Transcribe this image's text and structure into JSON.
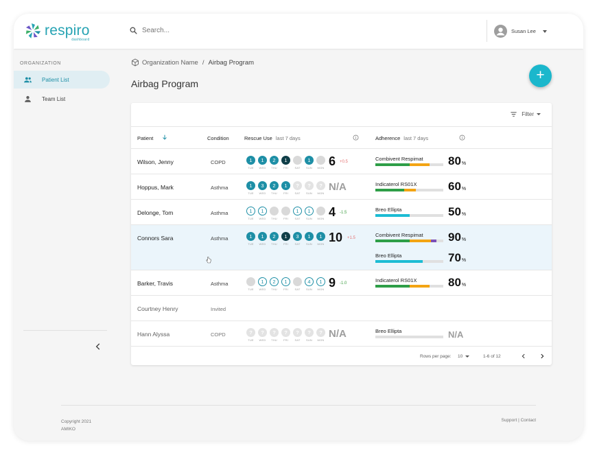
{
  "brand": {
    "name": "respiro",
    "sub": "dashboard",
    "colors": [
      "#26a3b3",
      "#3fb06a",
      "#6b57c7",
      "#1e8fa6"
    ]
  },
  "search": {
    "placeholder": "Search..."
  },
  "user": {
    "name": "Susan Lee"
  },
  "sidebar": {
    "heading": "ORGANIZATION",
    "items": [
      {
        "label": "Patient List",
        "icon": "patients-icon",
        "active": true
      },
      {
        "label": "Team List",
        "icon": "team-icon",
        "active": false
      }
    ]
  },
  "breadcrumb": {
    "org": "Organization Name",
    "separator": "/",
    "current": "Airbag Program"
  },
  "page_title": "Airbag Program",
  "filter_label": "Filter",
  "table": {
    "headers": {
      "patient": "Patient",
      "condition": "Condition",
      "rescue": "Rescue Use",
      "rescue_period": "last 7 days",
      "adherence": "Adherence",
      "adherence_period": "last 7 days"
    },
    "day_labels": [
      "TUE",
      "WED",
      "THU",
      "FRI",
      "SAT",
      "SUN",
      "MON"
    ],
    "rows": [
      {
        "name": "Wilson, Jenny",
        "condition": "COPD",
        "dim": false,
        "selected": false,
        "days": [
          {
            "v": "1",
            "s": "full"
          },
          {
            "v": "1",
            "s": "full"
          },
          {
            "v": "2",
            "s": "full"
          },
          {
            "v": "1",
            "s": "dark"
          },
          {
            "v": "",
            "s": "empty"
          },
          {
            "v": "1",
            "s": "full"
          },
          {
            "v": "",
            "s": "empty"
          }
        ],
        "total": "6",
        "delta": "+0.5",
        "delta_dir": "up",
        "meds": [
          {
            "name": "Combivent Respimat",
            "pct": "80",
            "bar": [
              {
                "c": "#2e9e47",
                "w": 0.51
              },
              {
                "c": "#f3a413",
                "w": 0.29
              }
            ]
          }
        ]
      },
      {
        "name": "Hoppus, Mark",
        "condition": "Asthma",
        "dim": false,
        "selected": false,
        "days": [
          {
            "v": "1",
            "s": "full"
          },
          {
            "v": "3",
            "s": "full"
          },
          {
            "v": "2",
            "s": "full"
          },
          {
            "v": "1",
            "s": "full"
          },
          {
            "v": "?",
            "s": "unk"
          },
          {
            "v": "?",
            "s": "unk"
          },
          {
            "v": "?",
            "s": "unk"
          }
        ],
        "total": "N/A",
        "delta": "",
        "delta_dir": "",
        "meds": [
          {
            "name": "Indicaterol RS01X",
            "pct": "60",
            "bar": [
              {
                "c": "#2e9e47",
                "w": 0.42
              },
              {
                "c": "#f3a413",
                "w": 0.18
              }
            ]
          }
        ]
      },
      {
        "name": "Delonge, Tom",
        "condition": "Asthma",
        "dim": false,
        "selected": false,
        "days": [
          {
            "v": "1",
            "s": "outline"
          },
          {
            "v": "1",
            "s": "outline"
          },
          {
            "v": "",
            "s": "empty"
          },
          {
            "v": "",
            "s": "empty"
          },
          {
            "v": "1",
            "s": "outline"
          },
          {
            "v": "1",
            "s": "outline"
          },
          {
            "v": "",
            "s": "empty"
          }
        ],
        "total": "4",
        "delta": "-1.5",
        "delta_dir": "down",
        "meds": [
          {
            "name": "Breo Ellipta",
            "pct": "50",
            "bar": [
              {
                "c": "#1cbcd4",
                "w": 0.5
              }
            ]
          }
        ]
      },
      {
        "name": "Connors Sara",
        "condition": "Asthma",
        "dim": false,
        "selected": true,
        "days": [
          {
            "v": "1",
            "s": "full"
          },
          {
            "v": "1",
            "s": "full"
          },
          {
            "v": "2",
            "s": "full"
          },
          {
            "v": "1",
            "s": "dark"
          },
          {
            "v": "3",
            "s": "full"
          },
          {
            "v": "1",
            "s": "full"
          },
          {
            "v": "1",
            "s": "full"
          }
        ],
        "total": "10",
        "delta": "+1.5",
        "delta_dir": "up",
        "meds": [
          {
            "name": "Combivent Respimat",
            "pct": "90",
            "bar": [
              {
                "c": "#2e9e47",
                "w": 0.5
              },
              {
                "c": "#f3a413",
                "w": 0.32
              },
              {
                "c": "#7b4fb8",
                "w": 0.08
              }
            ]
          },
          {
            "name": "Breo Ellipta",
            "pct": "70",
            "bar": [
              {
                "c": "#1cbcd4",
                "w": 0.7
              }
            ]
          }
        ]
      },
      {
        "name": "Barker, Travis",
        "condition": "Asthma",
        "dim": false,
        "selected": false,
        "days": [
          {
            "v": "",
            "s": "empty"
          },
          {
            "v": "1",
            "s": "outline"
          },
          {
            "v": "2",
            "s": "outline"
          },
          {
            "v": "1",
            "s": "outline"
          },
          {
            "v": "",
            "s": "empty"
          },
          {
            "v": "4",
            "s": "outline"
          },
          {
            "v": "1",
            "s": "outline"
          }
        ],
        "total": "9",
        "delta": "-1.0",
        "delta_dir": "down",
        "meds": [
          {
            "name": "Indicaterol RS01X",
            "pct": "80",
            "bar": [
              {
                "c": "#2e9e47",
                "w": 0.51
              },
              {
                "c": "#f3a413",
                "w": 0.29
              }
            ]
          }
        ]
      },
      {
        "name": "Courtney Henry",
        "condition": "Invited",
        "dim": true,
        "selected": false,
        "days": [],
        "total": "",
        "delta": "",
        "delta_dir": "",
        "meds": []
      },
      {
        "name": "Hann Alyssa",
        "condition": "COPD",
        "dim": true,
        "selected": false,
        "days": [
          {
            "v": "?",
            "s": "unk"
          },
          {
            "v": "?",
            "s": "unk"
          },
          {
            "v": "?",
            "s": "unk"
          },
          {
            "v": "?",
            "s": "unk"
          },
          {
            "v": "?",
            "s": "unk"
          },
          {
            "v": "?",
            "s": "unk"
          },
          {
            "v": "?",
            "s": "unk"
          }
        ],
        "total": "N/A",
        "delta": "",
        "delta_dir": "",
        "meds": [
          {
            "name": "Breo Ellipta",
            "pct": "N/A",
            "bar": []
          }
        ]
      }
    ]
  },
  "pagination": {
    "rows_per_page_label": "Rows per page:",
    "rows_per_page": "10",
    "range": "1-6 of 12"
  },
  "footer": {
    "copyright": "Copyright 2021",
    "company": "AMIKO",
    "support": "Support",
    "sep": "|",
    "contact": "Contact"
  }
}
